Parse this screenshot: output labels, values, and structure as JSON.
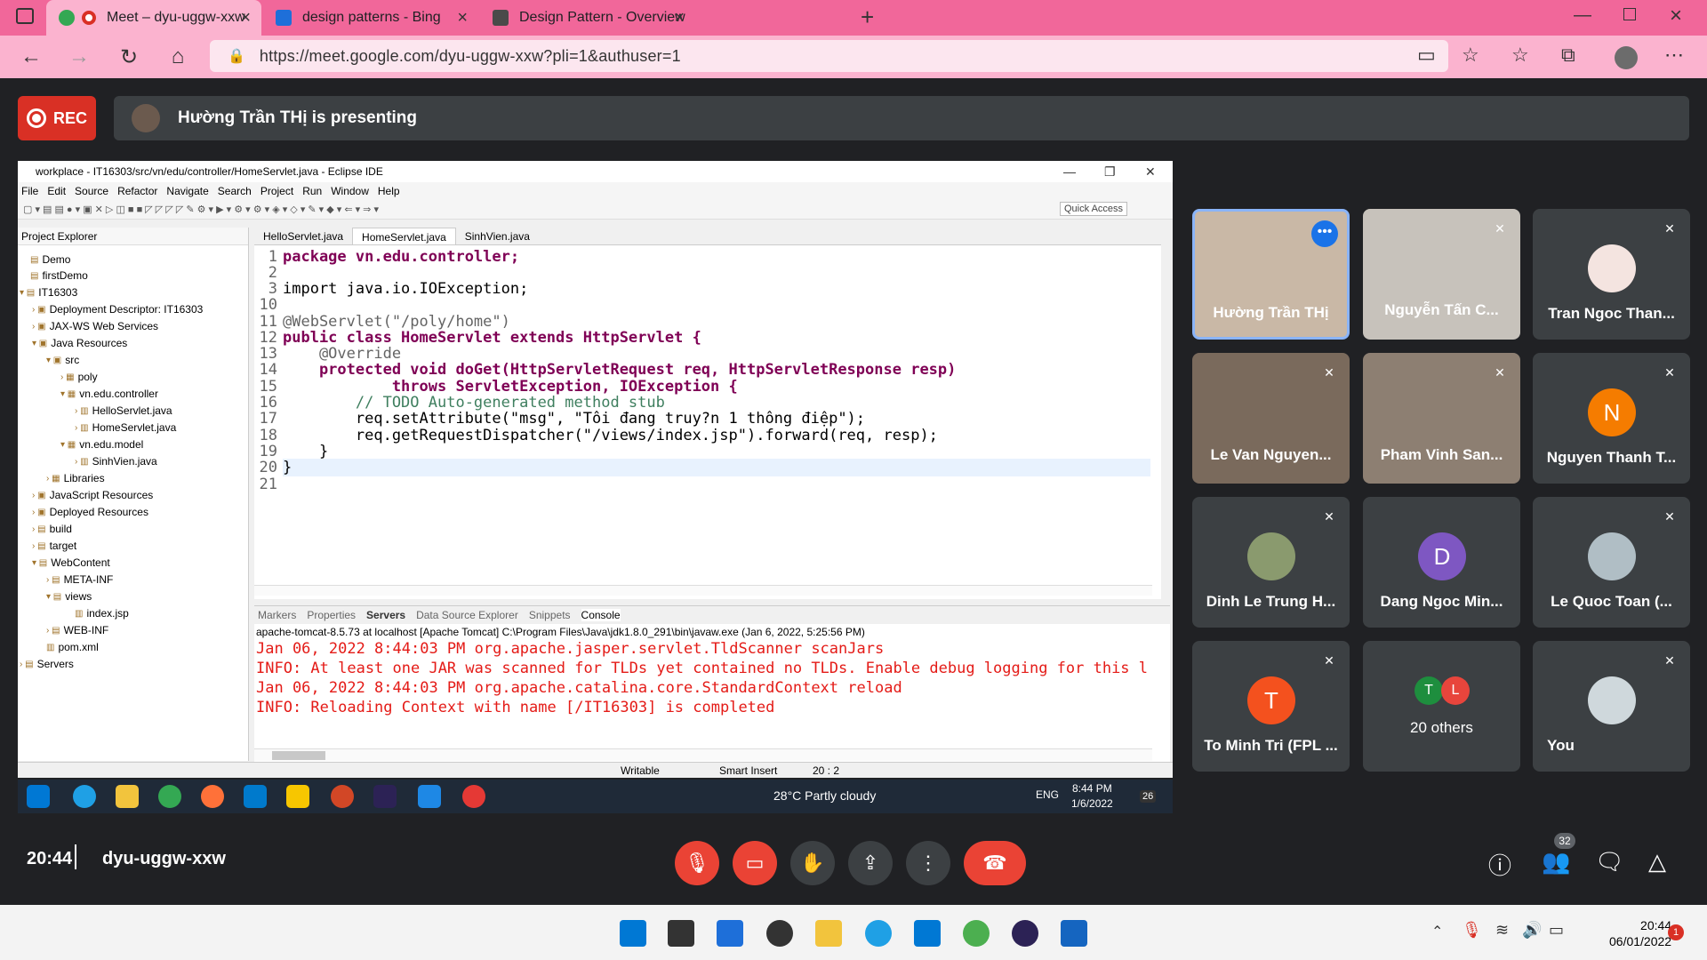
{
  "browser": {
    "tabs": [
      {
        "label": "Meet – dyu-uggw-xxw",
        "active": true
      },
      {
        "label": "design patterns - Bing",
        "active": false
      },
      {
        "label": "Design Pattern - Overview",
        "active": false
      }
    ],
    "url": "https://meet.google.com/dyu-uggw-xxw?pli=1&authuser=1",
    "accent_color": "#f1679a"
  },
  "meet": {
    "rec_label": "REC",
    "presenting_text": "Hường Trần THị is presenting",
    "time": "20:44",
    "meeting_code": "dyu-uggw-xxw",
    "participants_badge": "32",
    "participants": [
      {
        "name": "Hường Trần THị",
        "avatar": "",
        "muted": false,
        "speaking": true
      },
      {
        "name": "Nguyễn Tấn C...",
        "avatar": "",
        "muted": true
      },
      {
        "name": "Tran Ngoc Than...",
        "avatar": "",
        "muted": true
      },
      {
        "name": "Le Van Nguyen...",
        "avatar": "",
        "muted": true
      },
      {
        "name": "Pham Vinh San...",
        "avatar": "",
        "muted": true
      },
      {
        "name": "Nguyen Thanh T...",
        "avatar": "N",
        "muted": true
      },
      {
        "name": "Dinh Le Trung H...",
        "avatar": "",
        "muted": true
      },
      {
        "name": "Dang Ngoc Min...",
        "avatar": "D",
        "muted": true
      },
      {
        "name": "Le Quoc Toan (...",
        "avatar": "",
        "muted": true
      },
      {
        "name": "To Minh Tri (FPL ...",
        "avatar": "T",
        "muted": true
      },
      {
        "name": "20 others",
        "avatar": "T L",
        "muted": false
      },
      {
        "name": "You",
        "avatar": "",
        "muted": true
      }
    ]
  },
  "eclipse": {
    "title": "workplace - IT16303/src/vn/edu/controller/HomeServlet.java - Eclipse IDE",
    "menu": [
      "File",
      "Edit",
      "Source",
      "Refactor",
      "Navigate",
      "Search",
      "Project",
      "Run",
      "Window",
      "Help"
    ],
    "quick_access": "Quick Access",
    "project_explorer_title": "Project Explorer",
    "tree": [
      "Demo",
      "firstDemo",
      "IT16303",
      "Deployment Descriptor: IT16303",
      "JAX-WS Web Services",
      "Java Resources",
      "src",
      "poly",
      "vn.edu.controller",
      "HelloServlet.java",
      "HomeServlet.java",
      "vn.edu.model",
      "SinhVien.java",
      "Libraries",
      "JavaScript Resources",
      "Deployed Resources",
      "build",
      "target",
      "WebContent",
      "META-INF",
      "views",
      "index.jsp",
      "WEB-INF",
      "pom.xml",
      "Servers"
    ],
    "editor_tabs": [
      "HelloServlet.java",
      "HomeServlet.java",
      "SinhVien.java"
    ],
    "line_numbers": [
      "1",
      "2",
      "3",
      "10",
      "11",
      "12",
      "13",
      "14",
      "15",
      "16",
      "17",
      "18",
      "19",
      "20",
      "21"
    ],
    "code_lines": [
      "package vn.edu.controller;",
      "",
      "import java.io.IOException;",
      "",
      "@WebServlet(\"/poly/home\")",
      "public class HomeServlet extends HttpServlet {",
      "    @Override",
      "    protected void doGet(HttpServletRequest req, HttpServletResponse resp)",
      "            throws ServletException, IOException {",
      "        // TODO Auto-generated method stub",
      "        req.setAttribute(\"msg\", \"Tôi đang truy?n 1 thông điệp\");",
      "        req.getRequestDispatcher(\"/views/index.jsp\").forward(req, resp);",
      "    }",
      "}",
      ""
    ],
    "console_tabs": [
      "Markers",
      "Properties",
      "Servers",
      "Data Source Explorer",
      "Snippets",
      "Console"
    ],
    "console_header": "apache-tomcat-8.5.73 at localhost [Apache Tomcat] C:\\Program Files\\Java\\jdk1.8.0_291\\bin\\javaw.exe (Jan 6, 2022, 5:25:56 PM)",
    "console_lines": [
      "Jan 06, 2022 8:44:03 PM org.apache.jasper.servlet.TldScanner scanJars",
      "INFO: At least one JAR was scanned for TLDs yet contained no TLDs. Enable debug logging for this l",
      "Jan 06, 2022 8:44:03 PM org.apache.catalina.core.StandardContext reload",
      "INFO: Reloading Context with name [/IT16303] is completed"
    ],
    "status": {
      "writable": "Writable",
      "insert": "Smart Insert",
      "position": "20 : 2"
    }
  },
  "inner_taskbar": {
    "weather": "28°C  Partly cloudy",
    "lang": "ENG",
    "time": "8:44 PM",
    "date": "1/6/2022",
    "notif": "26"
  },
  "windows_taskbar": {
    "time": "20:44",
    "date": "06/01/2022",
    "notif": "1"
  }
}
